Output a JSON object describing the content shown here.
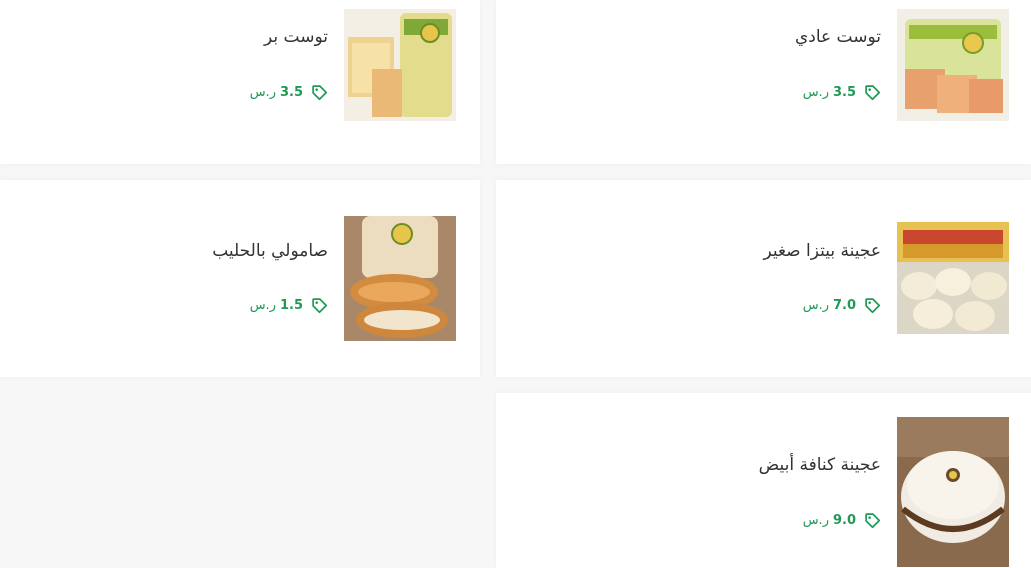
{
  "colors": {
    "accent_green": "#1f9a55",
    "text_dark": "#333333",
    "card_bg": "#ffffff",
    "page_bg": "#f7f7f7"
  },
  "products": [
    {
      "name": "توست عادي",
      "price": "3.5",
      "currency": "ر.س",
      "icon": "price-tag-icon",
      "image": "plain-toast-bread-photo"
    },
    {
      "name": "توست بر",
      "price": "3.5",
      "currency": "ر.س",
      "icon": "price-tag-icon",
      "image": "wheat-toast-bread-photo"
    },
    {
      "name": "عجينة بيتزا صغير",
      "price": "7.0",
      "currency": "ر.س",
      "icon": "price-tag-icon",
      "image": "small-pizza-dough-photo"
    },
    {
      "name": "صامولي بالحليب",
      "price": "1.5",
      "currency": "ر.س",
      "icon": "price-tag-icon",
      "image": "milk-buns-photo"
    },
    {
      "name": "عجينة كنافة أبيض",
      "price": "9.0",
      "currency": "ر.س",
      "icon": "price-tag-icon",
      "image": "white-kunafa-dough-photo"
    }
  ]
}
